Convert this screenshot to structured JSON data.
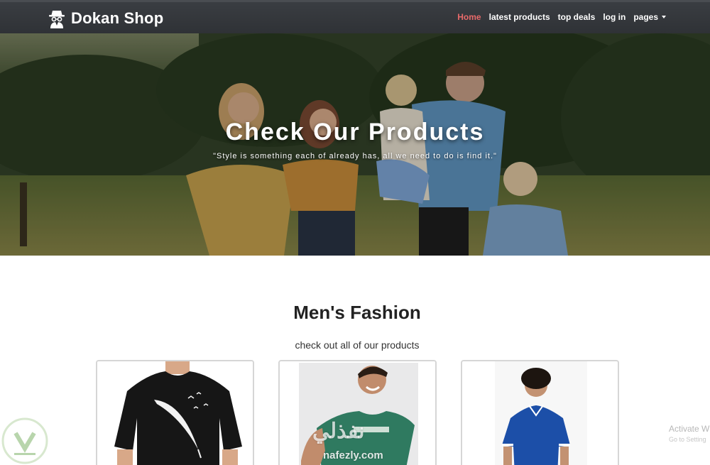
{
  "navbar": {
    "brand": "Dokan Shop",
    "brand_icon": "spy-icon",
    "links": [
      {
        "label": "Home",
        "active": true
      },
      {
        "label": "latest products",
        "active": false
      },
      {
        "label": "top deals",
        "active": false
      },
      {
        "label": "log in",
        "active": false
      },
      {
        "label": "pages",
        "active": false,
        "dropdown": true
      }
    ]
  },
  "hero": {
    "title": "Check Our Products",
    "quote": "\"Style is something each of already has, all we need to do is find it.\""
  },
  "section": {
    "title": "Men's Fashion",
    "subtitle": "check out all of our products"
  },
  "products": [
    {
      "name": "black feather t-shirt"
    },
    {
      "name": "green graphic t-shirt"
    },
    {
      "name": "blue polo shirt"
    }
  ],
  "watermark": {
    "arabic": "نفذلي",
    "url": "nafezly.com"
  },
  "os_notice": {
    "line1": "Activate W",
    "line2": "Go to Setting"
  },
  "colors": {
    "navbar_bg": "#2f3236",
    "active_link": "#e86a6a",
    "card_border": "#d6d6d6"
  }
}
